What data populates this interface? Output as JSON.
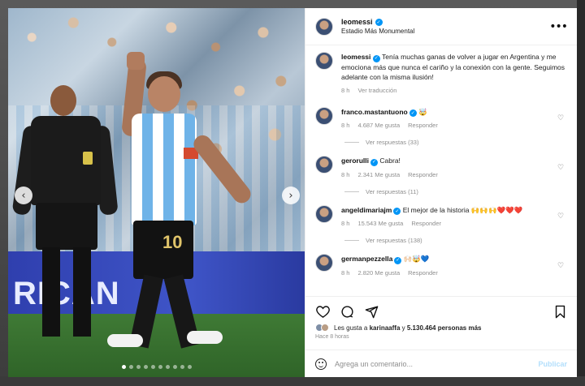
{
  "post": {
    "username": "leomessi",
    "location": "Estadio Más Monumental"
  },
  "photo": {
    "board_text": "RICAN",
    "player_number": "10",
    "slide_count": 10,
    "active_slide": 1
  },
  "caption": {
    "username": "leomessi",
    "text": "Tenía muchas ganas de volver a jugar en Argentina y me emociona más que nunca el cariño y la conexión con la gente. Seguimos adelante con la misma ilusión!",
    "time": "8 h",
    "translate": "Ver traducción"
  },
  "comments": [
    {
      "username": "franco.mastantuono",
      "text": "🤯",
      "time": "8 h",
      "likes": "4.687 Me gusta",
      "reply": "Responder",
      "replies": "Ver respuestas (33)"
    },
    {
      "username": "gerorulli",
      "text": "Cabra!",
      "time": "8 h",
      "likes": "2.341 Me gusta",
      "reply": "Responder",
      "replies": "Ver respuestas (11)"
    },
    {
      "username": "angeldimariajm",
      "text": "El mejor de la historia 🙌🙌🙌❤️❤️❤️",
      "time": "8 h",
      "likes": "15.543 Me gusta",
      "reply": "Responder",
      "replies": "Ver respuestas (138)"
    },
    {
      "username": "germanpezzella",
      "text": "🙌🏻🤯💙",
      "time": "8 h",
      "likes": "2.820 Me gusta",
      "reply": "Responder",
      "replies": ""
    }
  ],
  "likes": {
    "text_prefix": "Les gusta a",
    "liker": "karinaaffa",
    "text_middle": "y",
    "count": "5.130.464 personas más"
  },
  "time_ago": "Hace 8 horas",
  "add_comment": {
    "placeholder": "Agrega un comentario...",
    "publish": "Publicar"
  },
  "colors": {
    "verified": "#0095f6",
    "publish_disabled": "#b2dffc"
  }
}
